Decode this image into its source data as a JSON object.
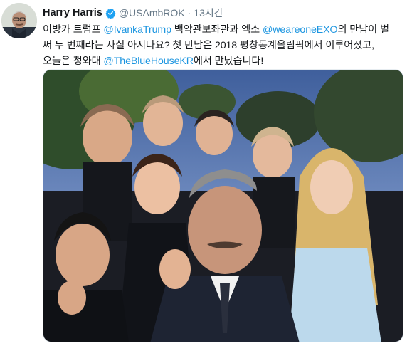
{
  "tweet": {
    "author_name": "Harry Harris",
    "author_handle": "@USAmbROK",
    "separator": "·",
    "time_ago": "13시간",
    "text": {
      "line1_part1": "이방카 트럼프 ",
      "line1_mention1": "@IvankaTrump",
      "line1_part2": " 백악관보좌관과 엑소 ",
      "line1_mention2": "@weareoneEXO",
      "line1_part3": "의 만남이 벌",
      "line2": "써 두 번째라는 사실 아시나요? 첫 만남은 2018 평창동계올림픽에서 이루어졌고,",
      "line3_part1": "오늘은 청와대 ",
      "line3_mention": "@TheBlueHouseKR",
      "line3_part2": "에서 만났습니다!"
    },
    "icons": {
      "verified": "verified-badge-icon",
      "avatar": "profile-avatar"
    },
    "colors": {
      "name": "#14171a",
      "meta": "#657786",
      "mention": "#1b95e0",
      "verified": "#1da1f2"
    }
  }
}
